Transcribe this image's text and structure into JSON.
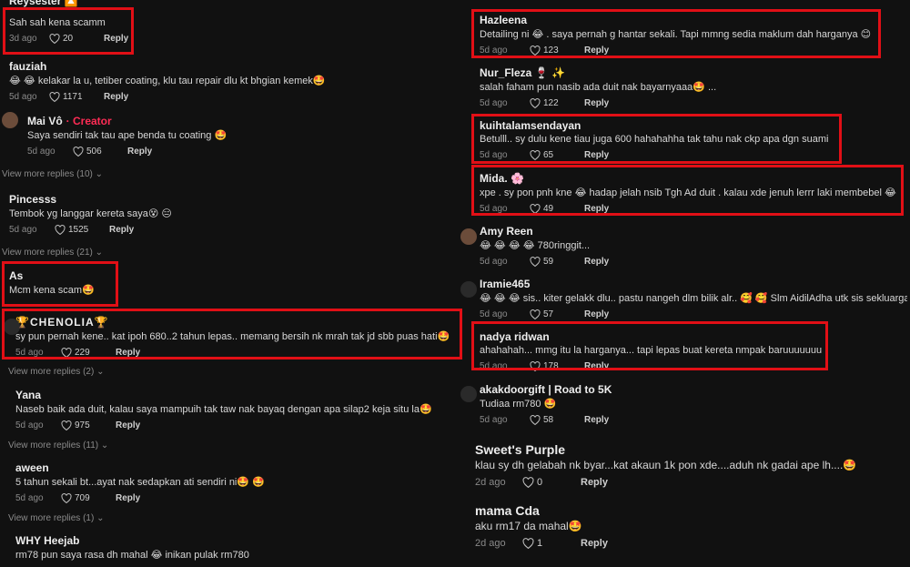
{
  "icons": {
    "heart": "heart-icon",
    "chevron": "chevron-down-icon"
  },
  "left": {
    "cut_name": "Reysester 🔼",
    "comments": [
      {
        "name": "",
        "text": "Sah sah kena scamm",
        "time": "3d ago",
        "likes": "20",
        "reply": "Reply"
      },
      {
        "name": "fauziah",
        "text": "😂 😂  kelakar la u, tetiber coating, klu tau repair dlu kt bhgian kemek🤩",
        "time": "5d ago",
        "likes": "1171",
        "reply": "Reply"
      },
      {
        "name": "Mai Vô",
        "creator": "· Creator",
        "text": "Saya sendiri tak tau ape benda tu coating 🤩",
        "time": "5d ago",
        "likes": "506",
        "reply": "Reply"
      },
      {
        "name": "Pincesss",
        "text": "Tembok yg langgar kereta saya😵 😑",
        "time": "5d ago",
        "likes": "1525",
        "reply": "Reply"
      },
      {
        "name": "As",
        "text": "Mcm kena scam🤩",
        "time": "",
        "likes": "",
        "reply": ""
      },
      {
        "name": "🏆CHENOLIA🏆",
        "text": "sy pun pernah kene.. kat ipoh 680..2 tahun lepas.. memang bersih nk mrah tak jd sbb puas hati🤩",
        "time": "5d ago",
        "likes": "229",
        "reply": "Reply"
      },
      {
        "name": "Yana",
        "text": "Naseb baik ada duit, kalau saya mampuih tak taw nak bayaq dengan apa silap2 keja situ la🤩",
        "time": "5d ago",
        "likes": "975",
        "reply": "Reply"
      },
      {
        "name": "aween",
        "text": "5 tahun sekali bt...ayat nak sedapkan ati sendiri ni🤩 🤩",
        "time": "5d ago",
        "likes": "709",
        "reply": "Reply"
      },
      {
        "name": "WHY Heejab",
        "text": "rm78 pun saya rasa dh mahal 😂 inikan pulak rm780",
        "time": "",
        "likes": "",
        "reply": ""
      }
    ],
    "view_more": [
      "View more replies (10)",
      "View more replies (21)",
      "View more replies (2)",
      "View more replies (11)",
      "View more replies (1)"
    ]
  },
  "right": {
    "comments": [
      {
        "name": "Hazleena",
        "text": "Detailing ni 😂 . saya pernah g hantar sekali. Tapi mmng sedia maklum dah harganya 😊",
        "time": "5d ago",
        "likes": "123",
        "reply": "Reply"
      },
      {
        "name": "Nur_Fleza 🍷 ✨",
        "text": "salah faham pun nasib ada duit nak bayarnyaaa🤩 ...",
        "time": "5d ago",
        "likes": "122",
        "reply": "Reply"
      },
      {
        "name": "kuihtalamsendayan",
        "text": "Betulll.. sy dulu kene tiau juga 600 hahahahha tak tahu nak ckp apa dgn suami",
        "time": "5d ago",
        "likes": "65",
        "reply": "Reply"
      },
      {
        "name": "Mida. 🌸",
        "text": "xpe . sy pon pnh kne 😂  hadap jelah nsib Tgh Ad duit . kalau xde jenuh lerrr laki membebel 😂",
        "time": "5d ago",
        "likes": "49",
        "reply": "Reply"
      },
      {
        "name": "Amy Reen",
        "text": "😂 😂 😂 😂  780ringgit...",
        "time": "5d ago",
        "likes": "59",
        "reply": "Reply"
      },
      {
        "name": "Iramie465",
        "text": "😂 😂 😂 sis.. kiter gelakk dlu.. pastu nangeh dlm bilik alr.. 🥰 🥰 Slm AidilAdha utk sis sekluarga..",
        "time": "5d ago",
        "likes": "57",
        "reply": "Reply"
      },
      {
        "name": "nadya ridwan",
        "text": "ahahahah... mmg itu la harganya... tapi lepas buat kereta nmpak baruuuuuuu",
        "time": "5d ago",
        "likes": "178",
        "reply": "Reply"
      },
      {
        "name": "akakdoorgift | Road to 5K",
        "text": "Tudiaa rm780 🤩",
        "time": "5d ago",
        "likes": "58",
        "reply": "Reply"
      },
      {
        "name": "Sweet's Purple",
        "text": "klau sy dh gelabah nk byar...kat akaun 1k pon xde....aduh nk gadai ape lh....🤩",
        "time": "2d ago",
        "likes": "0",
        "reply": "Reply"
      },
      {
        "name": "mama Cda",
        "text": "aku rm17 da mahal🤩",
        "time": "2d ago",
        "likes": "1",
        "reply": "Reply"
      }
    ]
  }
}
